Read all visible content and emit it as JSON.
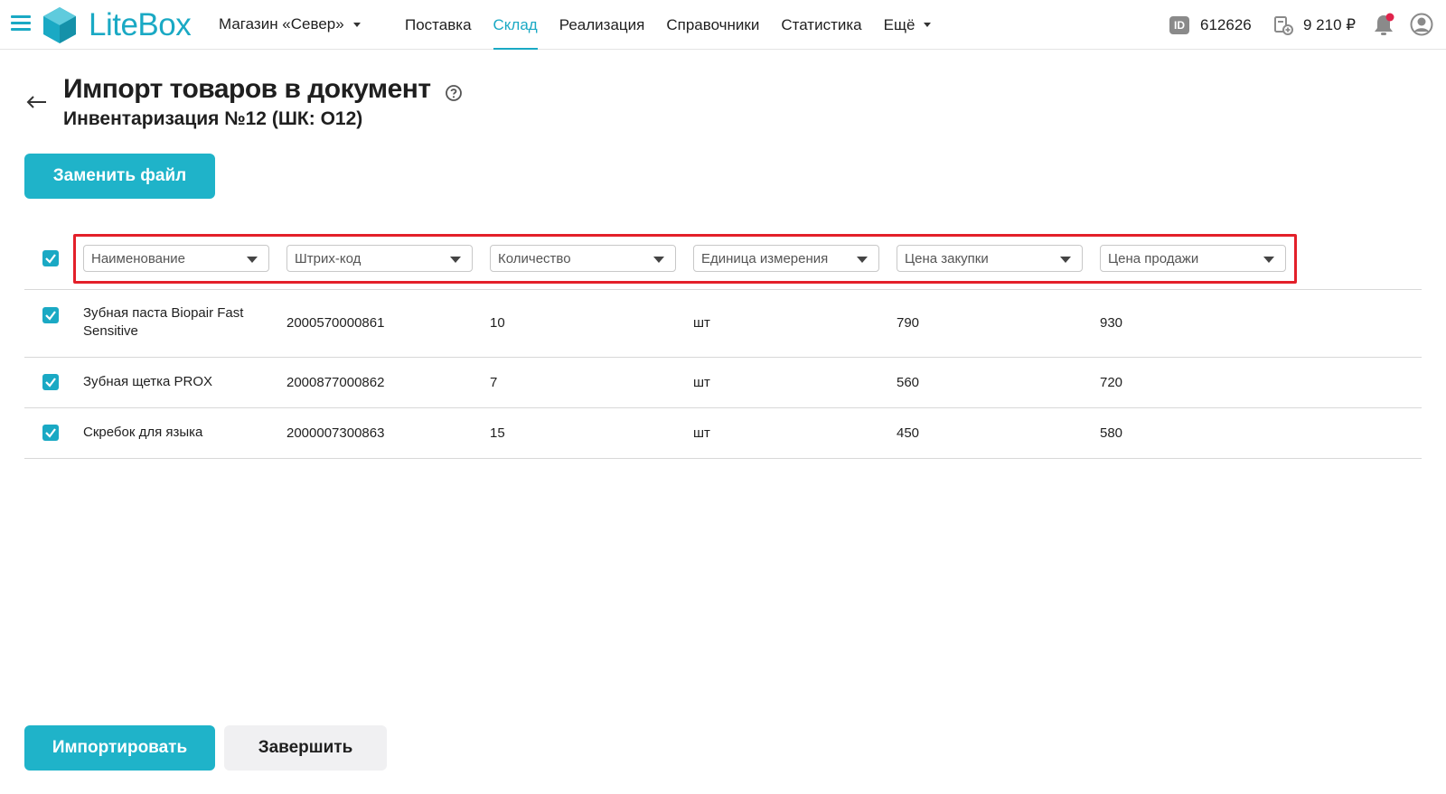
{
  "header": {
    "logo_text": "LiteBox",
    "store": "Магазин «Север»",
    "nav": [
      "Поставка",
      "Склад",
      "Реализация",
      "Справочники",
      "Статистика"
    ],
    "nav_more": "Ещё",
    "id_badge": "ID",
    "account_id": "612626",
    "balance": "9 210 ₽",
    "accent_color": "#1aa9c4",
    "notification_color": "#e0234b"
  },
  "page": {
    "title": "Импорт товаров в документ",
    "subtitle": "Инвентаризация №12 (ШК: О12)",
    "replace_file_button": "Заменить файл",
    "import_button": "Импортировать",
    "finish_button": "Завершить"
  },
  "columns": [
    "Наименование",
    "Штрих-код",
    "Количество",
    "Единица измерения",
    "Цена закупки",
    "Цена продажи"
  ],
  "rows": [
    [
      "Зубная паста Biopair Fast Sensitive",
      "2000570000861",
      "10",
      "шт",
      "790",
      "930"
    ],
    [
      "Зубная щетка PROX",
      "2000877000862",
      "7",
      "шт",
      "560",
      "720"
    ],
    [
      "Скребок для языка",
      "2000007300863",
      "15",
      "шт",
      "450",
      "580"
    ]
  ]
}
